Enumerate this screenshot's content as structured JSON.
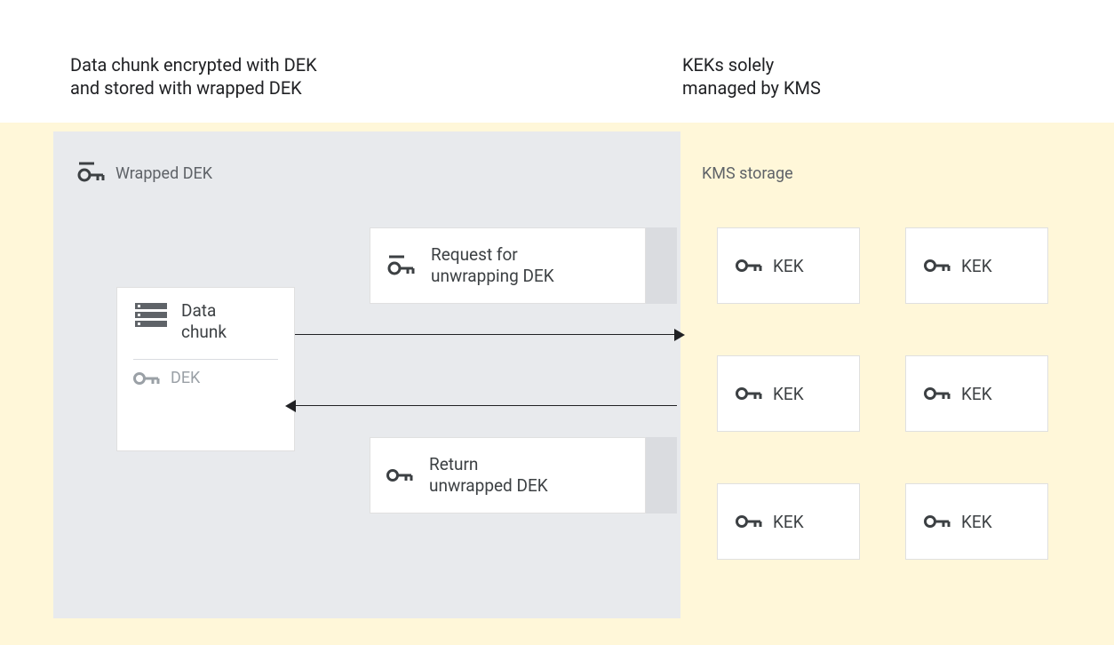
{
  "headings": {
    "left_line1": "Data chunk encrypted with DEK",
    "left_line2": "and stored with wrapped DEK",
    "right_line1": "KEKs solely",
    "right_line2": "managed by KMS"
  },
  "regions": {
    "wrapped_dek_label": "Wrapped DEK",
    "kms_label": "KMS storage"
  },
  "data_chunk": {
    "title_line1": "Data",
    "title_line2": "chunk",
    "dek_label": "DEK"
  },
  "flows": {
    "request_line1": "Request for",
    "request_line2": "unwrapping DEK",
    "return_line1": "Return",
    "return_line2": "unwrapped DEK"
  },
  "kek": {
    "label": "KEK"
  },
  "icons": {
    "key": "key-icon",
    "storage": "storage-icon",
    "key_wrapped": "wrapped-key-icon"
  }
}
